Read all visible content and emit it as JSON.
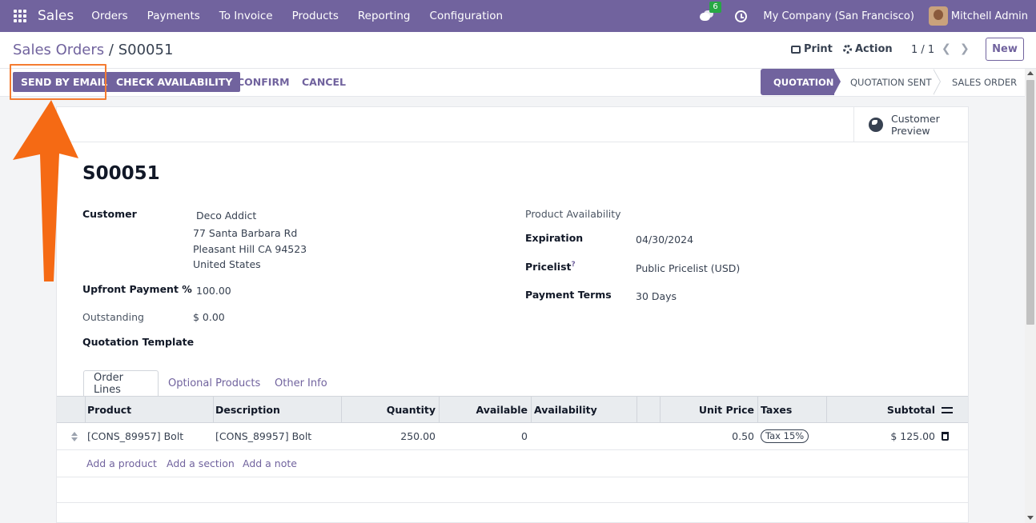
{
  "navbar": {
    "app_name": "Sales",
    "menu": [
      "Orders",
      "Payments",
      "To Invoice",
      "Products",
      "Reporting",
      "Configuration"
    ],
    "message_count": "6",
    "company": "My Company (San Francisco)",
    "user": "Mitchell Admin"
  },
  "control_panel": {
    "breadcrumb_parent": "Sales Orders",
    "breadcrumb_sep": "/",
    "breadcrumb_current": "S00051",
    "print_label": "Print",
    "action_label": "Action",
    "pager": "1 / 1",
    "new_label": "New"
  },
  "statusbar": {
    "send_email": "SEND BY EMAIL",
    "check_availability": "CHECK AVAILABILITY",
    "confirm": "CONFIRM",
    "cancel": "CANCEL",
    "stages": [
      "QUOTATION",
      "QUOTATION SENT",
      "SALES ORDER"
    ],
    "active_stage": "QUOTATION"
  },
  "sheet": {
    "customer_preview_line1": "Customer",
    "customer_preview_line2": "Preview",
    "record_name": "S00051",
    "left_fields": {
      "customer_label": "Customer",
      "customer_name": "Deco Addict",
      "address_line1": "77 Santa Barbara Rd",
      "address_line2": "Pleasant Hill CA 94523",
      "address_line3": "United States",
      "upfront_label": "Upfront Payment %",
      "upfront_value": "100.00",
      "outstanding_label": "Outstanding",
      "outstanding_value": "$ 0.00",
      "template_label": "Quotation Template"
    },
    "right_fields": {
      "availability_label": "Product Availability",
      "expiration_label": "Expiration",
      "expiration_value": "04/30/2024",
      "pricelist_label": "Pricelist",
      "pricelist_help": "?",
      "pricelist_value": "Public Pricelist (USD)",
      "terms_label": "Payment Terms",
      "terms_value": "30 Days"
    },
    "tabs": [
      "Order Lines",
      "Optional Products",
      "Other Info"
    ],
    "columns": [
      "Product",
      "Description",
      "Quantity",
      "Available",
      "Availability",
      "Unit Price",
      "Taxes",
      "Subtotal"
    ],
    "lines": [
      {
        "product": "[CONS_89957] Bolt",
        "description": "[CONS_89957] Bolt",
        "quantity": "250.00",
        "available": "0",
        "unit_price": "0.50",
        "tax": "Tax 15%",
        "subtotal": "$ 125.00"
      }
    ],
    "add_links": [
      "Add a product",
      "Add a section",
      "Add a note"
    ]
  },
  "colors": {
    "brand": "#71639e",
    "annotation": "#f47c31"
  }
}
